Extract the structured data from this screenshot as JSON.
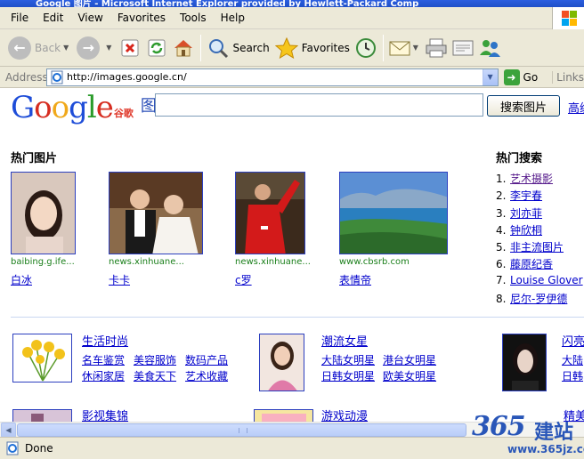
{
  "window": {
    "title": "Google 图片 - Microsoft Internet Explorer provided by Hewlett-Packard Comp"
  },
  "menu": [
    {
      "key": "F",
      "rest": "ile"
    },
    {
      "key": "E",
      "rest": "dit"
    },
    {
      "key": "V",
      "rest": "iew"
    },
    {
      "key": "F",
      "rest": "avorites",
      "prefix": ""
    },
    {
      "key": "T",
      "rest": "ools"
    },
    {
      "key": "H",
      "rest": "elp"
    }
  ],
  "menu_labels": [
    "File",
    "Edit",
    "View",
    "Favorites",
    "Tools",
    "Help"
  ],
  "toolbar": {
    "back": "Back",
    "search": "Search",
    "favorites": "Favorites"
  },
  "address": {
    "label": "Address",
    "url": "http://images.google.cn/",
    "go": "Go",
    "links": "Links"
  },
  "page": {
    "logo": "Google",
    "logo_cn": "谷歌",
    "logo_pics": "图片",
    "search_button": "搜索图片",
    "advanced": "高级",
    "hot_images_title": "热门图片",
    "hot_search_title": "热门搜索",
    "hot_images": [
      {
        "source": "baibing.g.ife...",
        "caption": "白冰"
      },
      {
        "source": "news.xinhuane...",
        "caption": "卡卡"
      },
      {
        "source": "news.xinhuane...",
        "caption": "c罗"
      },
      {
        "source": "www.cbsrb.com",
        "caption": "表情帝"
      }
    ],
    "hot_searches": [
      {
        "n": "1.",
        "text": "艺术摄影"
      },
      {
        "n": "2.",
        "text": "李宇春"
      },
      {
        "n": "3.",
        "text": "刘亦菲"
      },
      {
        "n": "4.",
        "text": "钟欣桐"
      },
      {
        "n": "5.",
        "text": "非主流图片"
      },
      {
        "n": "6.",
        "text": "藤原纪香"
      },
      {
        "n": "7.",
        "text": "Louise Glover"
      },
      {
        "n": "8.",
        "text": "尼尔-罗伊德"
      }
    ],
    "categories": [
      {
        "title": "生活时尚",
        "links": [
          "名车鉴赏",
          "美容服饰",
          "数码产品",
          "休闲家居",
          "美食天下",
          "艺术收藏"
        ]
      },
      {
        "title": "潮流女星",
        "links": [
          "大陆女明星",
          "港台女明星",
          "日韩女明星",
          "欧美女明星"
        ]
      },
      {
        "title": "闪亮",
        "links": [
          "大陆",
          "日韩"
        ]
      },
      {
        "title": "影视集锦",
        "links": []
      },
      {
        "title": "游戏动漫",
        "links": []
      },
      {
        "title": "精美",
        "links": []
      }
    ]
  },
  "status": {
    "text": "Done"
  },
  "watermark": {
    "brand_num": "365",
    "brand_zh": "建站",
    "url": "www.365jz.com"
  }
}
